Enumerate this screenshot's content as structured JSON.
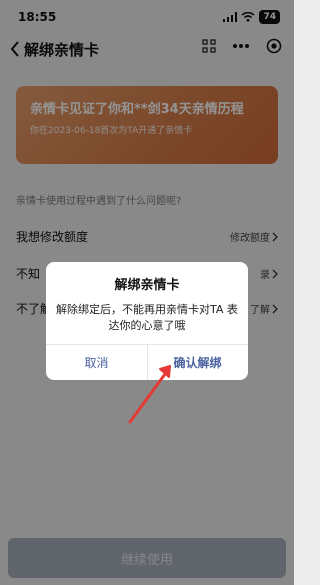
{
  "status": {
    "time": "18:55",
    "battery": "74"
  },
  "nav": {
    "title": "解绑亲情卡"
  },
  "card": {
    "title": "亲情卡见证了你和**剑34天亲情历程",
    "subtitle": "你在2023-06-18首次为TA开通了亲情卡"
  },
  "question": "亲情卡使用过程中遇到了什么问题呢?",
  "options": [
    {
      "label": "我想修改额度",
      "right": "修改额度"
    },
    {
      "label": "不知",
      "right": "录"
    },
    {
      "label": "不了解",
      "right": "了解"
    }
  ],
  "dialog": {
    "title": "解绑亲情卡",
    "message": "解除绑定后，不能再用亲情卡对TA 表达你的心意了哦",
    "cancel": "取消",
    "confirm": "确认解绑"
  },
  "bottom_button": "继续使用",
  "colors": {
    "card": "#d67d4a",
    "arrow": "#e53935",
    "dialog_text": "#4c63a0"
  }
}
